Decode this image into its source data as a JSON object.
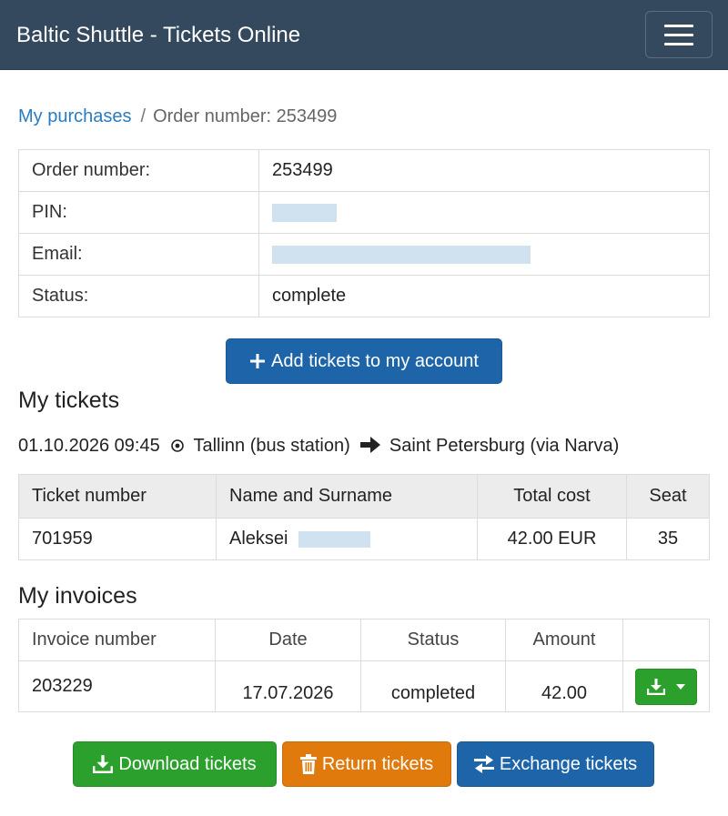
{
  "navbar": {
    "brand": "Baltic Shuttle - Tickets Online"
  },
  "breadcrumb": {
    "parent": "My purchases",
    "separator": "/",
    "current": "Order number: 253499"
  },
  "order": {
    "rows": [
      {
        "label": "Order number:",
        "value": "253499"
      },
      {
        "label": "PIN:",
        "value": ""
      },
      {
        "label": "Email:",
        "value": ""
      },
      {
        "label": "Status:",
        "value": "complete"
      }
    ]
  },
  "add_button": {
    "label": "Add tickets to my account"
  },
  "tickets_section": {
    "title": "My tickets",
    "trip": {
      "datetime": "01.10.2026 09:45",
      "from": "Tallinn (bus station)",
      "to": "Saint Petersburg (via Narva)"
    },
    "headers": [
      "Ticket number",
      "Name and Surname",
      "Total cost",
      "Seat"
    ],
    "rows": [
      {
        "ticket_number": "701959",
        "name": "Aleksei",
        "total_cost": "42.00 EUR",
        "seat": "35"
      }
    ]
  },
  "invoices_section": {
    "title": "My invoices",
    "headers": [
      "Invoice number",
      "Date",
      "Status",
      "Amount",
      ""
    ],
    "rows": [
      {
        "invoice_number": "203229",
        "date": "17.07.2026",
        "status": "completed",
        "amount": "42.00"
      }
    ]
  },
  "actions": {
    "download": "Download tickets",
    "return": "Return tickets",
    "exchange": "Exchange tickets"
  },
  "colors": {
    "navbar": "#34495e",
    "link": "#2a7bc0",
    "primary": "#1e64a8",
    "success": "#2ca02c",
    "warning": "#e07a0c",
    "redaction": "#d0e2f0"
  }
}
